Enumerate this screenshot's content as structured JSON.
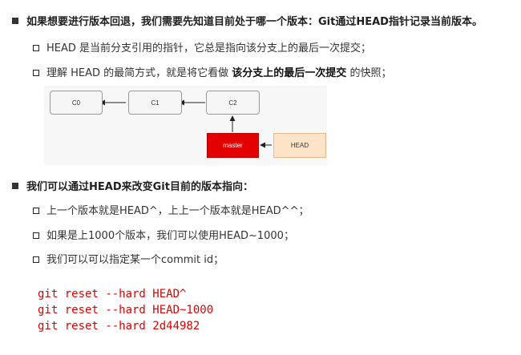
{
  "section1": {
    "heading": "如果想要进行版本回退，我们需要先知道目前处于哪一个版本：Git通过HEAD指针记录当前版本。",
    "point1": "HEAD 是当前分支引用的指针，它总是指向该分支上的最后一次提交；",
    "point2_pre": "理解 HEAD 的最简方式，就是将它看做 ",
    "point2_bold": "该分支上的最后一次提交",
    "point2_post": " 的快照；"
  },
  "diagram": {
    "commits": [
      "C0",
      "C1",
      "C2"
    ],
    "branch": "master",
    "head": "HEAD",
    "colors": {
      "branch": "#e30000",
      "head": "#fde4c9",
      "commit": "#f5f5f5"
    }
  },
  "section2": {
    "heading": "我们可以通过HEAD来改变Git目前的版本指向：",
    "point1": "上一个版本就是HEAD^，上上一个版本就是HEAD^^；",
    "point2": "如果是上1000个版本，我们可以使用HEAD~1000；",
    "point3": "我们可以可以指定某一个commit id；"
  },
  "code": {
    "lines": [
      "git reset --hard HEAD^",
      "git reset --hard HEAD~1000",
      "git reset --hard 2d44982"
    ],
    "color": "#e00000"
  }
}
